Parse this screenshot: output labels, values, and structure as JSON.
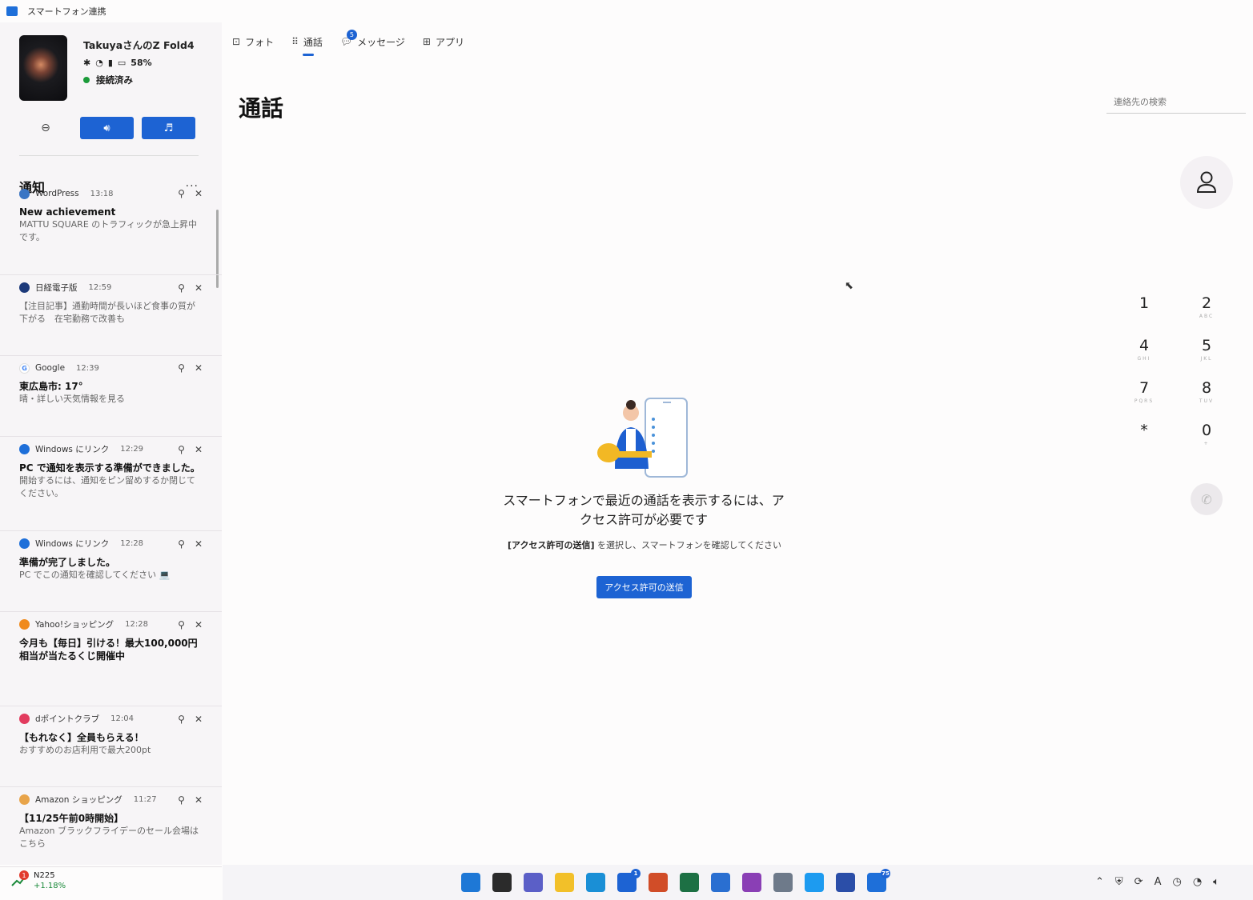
{
  "window": {
    "title": "スマートフォン連携"
  },
  "device": {
    "name": "TakuyaさんのZ Fold4",
    "battery": "58%",
    "connection": "接続済み"
  },
  "notifications_header": {
    "title": "通知",
    "more": "···"
  },
  "notifications": [
    {
      "app": "WordPress",
      "time": "13:18",
      "title": "New achievement",
      "body": "MATTU SQUARE のトラフィックが急上昇中です。",
      "icon_color": "#3a75c4",
      "icon": "wordpress-icon"
    },
    {
      "app": "日経電子版",
      "time": "12:59",
      "title": "",
      "body": "【注目記事】通勤時間が長いほど食事の質が下がる　在宅勤務で改善も",
      "icon_color": "#1d3a7a",
      "icon": "nikkei-icon"
    },
    {
      "app": "Google",
      "time": "12:39",
      "title": "東広島市: 17°",
      "body": "晴・詳しい天気情報を見る",
      "icon_color": "#ffffff",
      "icon": "google-icon"
    },
    {
      "app": "Windows にリンク",
      "time": "12:29",
      "title": "PC で通知を表示する準備ができました。",
      "body": "開始するには、通知をピン留めするか閉じてください。",
      "icon_color": "#1e6fd9",
      "icon": "link-to-windows-icon"
    },
    {
      "app": "Windows にリンク",
      "time": "12:28",
      "title": "準備が完了しました。",
      "body": "PC でこの通知を確認してください 💻",
      "icon_color": "#1e6fd9",
      "icon": "link-to-windows-icon"
    },
    {
      "app": "Yahoo!ショッピング",
      "time": "12:28",
      "title": "今月も【毎日】引ける！最大100,000円相当が当たるくじ開催中",
      "body": "",
      "icon_color": "#f08a1c",
      "icon": "yahoo-shopping-icon"
    },
    {
      "app": "dポイントクラブ",
      "time": "12:04",
      "title": "【もれなく】全員もらえる！",
      "body": "おすすめのお店利用で最大200pt",
      "icon_color": "#e23b5e",
      "icon": "d-point-icon"
    },
    {
      "app": "Amazon ショッピング",
      "time": "11:27",
      "title": "【11/25午前0時開始】",
      "body": "Amazon ブラックフライデーのセール会場はこちら",
      "icon_color": "#e8a44a",
      "icon": "amazon-icon"
    }
  ],
  "tabs": [
    {
      "label": "フォト",
      "icon": "photo-icon"
    },
    {
      "label": "通話",
      "icon": "dialpad-icon",
      "active": true
    },
    {
      "label": "メッセージ",
      "icon": "message-icon",
      "badge": "5"
    },
    {
      "label": "アプリ",
      "icon": "apps-icon"
    }
  ],
  "main": {
    "title": "通話",
    "search_placeholder": "連絡先の検索",
    "empty_title": "スマートフォンで最近の通話を表示するには、アクセス許可が必要です",
    "empty_sub_bold": "[アクセス許可の送信]",
    "empty_sub_rest": " を選択し、スマートフォンを確認してください",
    "access_button": "アクセス許可の送信"
  },
  "dialpad": [
    {
      "digit": "1",
      "letters": ""
    },
    {
      "digit": "2",
      "letters": "ABC"
    },
    {
      "digit": "4",
      "letters": "GHI"
    },
    {
      "digit": "5",
      "letters": "JKL"
    },
    {
      "digit": "7",
      "letters": "PQRS"
    },
    {
      "digit": "8",
      "letters": "TUV"
    },
    {
      "digit": "*",
      "letters": ""
    },
    {
      "digit": "0",
      "letters": "+"
    }
  ],
  "stock": {
    "name": "N225",
    "change": "+1.18%",
    "badge": "1"
  },
  "taskbar": {
    "apps": [
      {
        "name": "start",
        "color": "#1e78d6"
      },
      {
        "name": "task-view",
        "color": "#2b2b2b"
      },
      {
        "name": "chat",
        "color": "#5b5fc7"
      },
      {
        "name": "explorer",
        "color": "#f2c029"
      },
      {
        "name": "edge",
        "color": "#1a8fd6"
      },
      {
        "name": "store",
        "color": "#1d63d3",
        "badge": "1"
      },
      {
        "name": "powerpoint",
        "color": "#d14d28"
      },
      {
        "name": "excel",
        "color": "#1d7044"
      },
      {
        "name": "firefox",
        "color": "#2a6fd1"
      },
      {
        "name": "onenote",
        "color": "#8a3fb5"
      },
      {
        "name": "snipping",
        "color": "#6e7a8a"
      },
      {
        "name": "twitter",
        "color": "#1d9bf0"
      },
      {
        "name": "app-blue",
        "color": "#2b4ea8"
      },
      {
        "name": "phone-link",
        "color": "#1e6fd9",
        "badge": "75"
      }
    ],
    "badge_store": "1",
    "badge_phone": "75"
  }
}
